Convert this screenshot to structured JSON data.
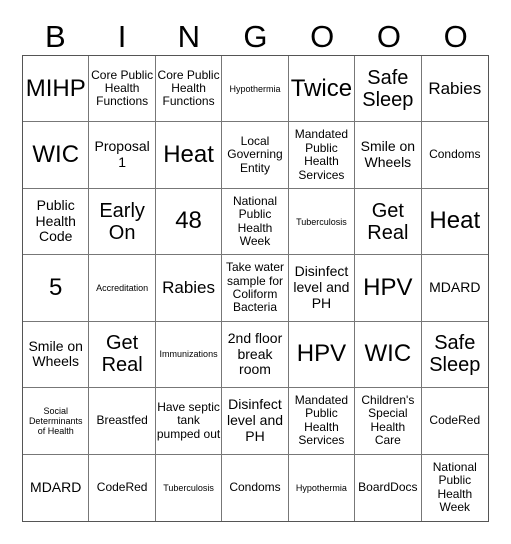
{
  "header": [
    "B",
    "I",
    "N",
    "G",
    "O",
    "O",
    "O"
  ],
  "cells": [
    [
      {
        "text": "MIHP",
        "size": "xl"
      },
      {
        "text": "Core Public Health Functions",
        "size": "sm"
      },
      {
        "text": "Core Public Health Functions",
        "size": "sm"
      },
      {
        "text": "Hypothermia",
        "size": "xs"
      },
      {
        "text": "Twice",
        "size": "xl"
      },
      {
        "text": "Safe Sleep",
        "size": "l"
      },
      {
        "text": "Rabies",
        "size": "m"
      }
    ],
    [
      {
        "text": "WIC",
        "size": "xl"
      },
      {
        "text": "Proposal 1",
        "size": "n"
      },
      {
        "text": "Heat",
        "size": "xl"
      },
      {
        "text": "Local Governing Entity",
        "size": "sm"
      },
      {
        "text": "Mandated Public Health Services",
        "size": "sm"
      },
      {
        "text": "Smile on Wheels",
        "size": "n"
      },
      {
        "text": "Condoms",
        "size": "sm"
      }
    ],
    [
      {
        "text": "Public Health Code",
        "size": "n"
      },
      {
        "text": "Early On",
        "size": "l"
      },
      {
        "text": "48",
        "size": "xl"
      },
      {
        "text": "National Public Health Week",
        "size": "sm"
      },
      {
        "text": "Tuberculosis",
        "size": "xs"
      },
      {
        "text": "Get Real",
        "size": "l"
      },
      {
        "text": "Heat",
        "size": "xl"
      }
    ],
    [
      {
        "text": "5",
        "size": "xl"
      },
      {
        "text": "Accreditation",
        "size": "xs"
      },
      {
        "text": "Rabies",
        "size": "m"
      },
      {
        "text": "Take water sample for Coliform Bacteria",
        "size": "sm"
      },
      {
        "text": "Disinfect level and PH",
        "size": "n"
      },
      {
        "text": "HPV",
        "size": "xl"
      },
      {
        "text": "MDARD",
        "size": "n"
      }
    ],
    [
      {
        "text": "Smile on Wheels",
        "size": "n"
      },
      {
        "text": "Get Real",
        "size": "l"
      },
      {
        "text": "Immunizations",
        "size": "xs"
      },
      {
        "text": "2nd floor break room",
        "size": "n"
      },
      {
        "text": "HPV",
        "size": "xl"
      },
      {
        "text": "WIC",
        "size": "xl"
      },
      {
        "text": "Safe Sleep",
        "size": "l"
      }
    ],
    [
      {
        "text": "Social Determinants of Health",
        "size": "xs"
      },
      {
        "text": "Breastfed",
        "size": "sm"
      },
      {
        "text": "Have septic tank pumped out",
        "size": "sm"
      },
      {
        "text": "Disinfect level and PH",
        "size": "n"
      },
      {
        "text": "Mandated Public Health Services",
        "size": "sm"
      },
      {
        "text": "Children's Special Health Care",
        "size": "sm"
      },
      {
        "text": "CodeRed",
        "size": "sm"
      }
    ],
    [
      {
        "text": "MDARD",
        "size": "n"
      },
      {
        "text": "CodeRed",
        "size": "sm"
      },
      {
        "text": "Tuberculosis",
        "size": "xs"
      },
      {
        "text": "Condoms",
        "size": "sm"
      },
      {
        "text": "Hypothermia",
        "size": "xs"
      },
      {
        "text": "BoardDocs",
        "size": "sm"
      },
      {
        "text": "National Public Health Week",
        "size": "sm"
      }
    ]
  ]
}
